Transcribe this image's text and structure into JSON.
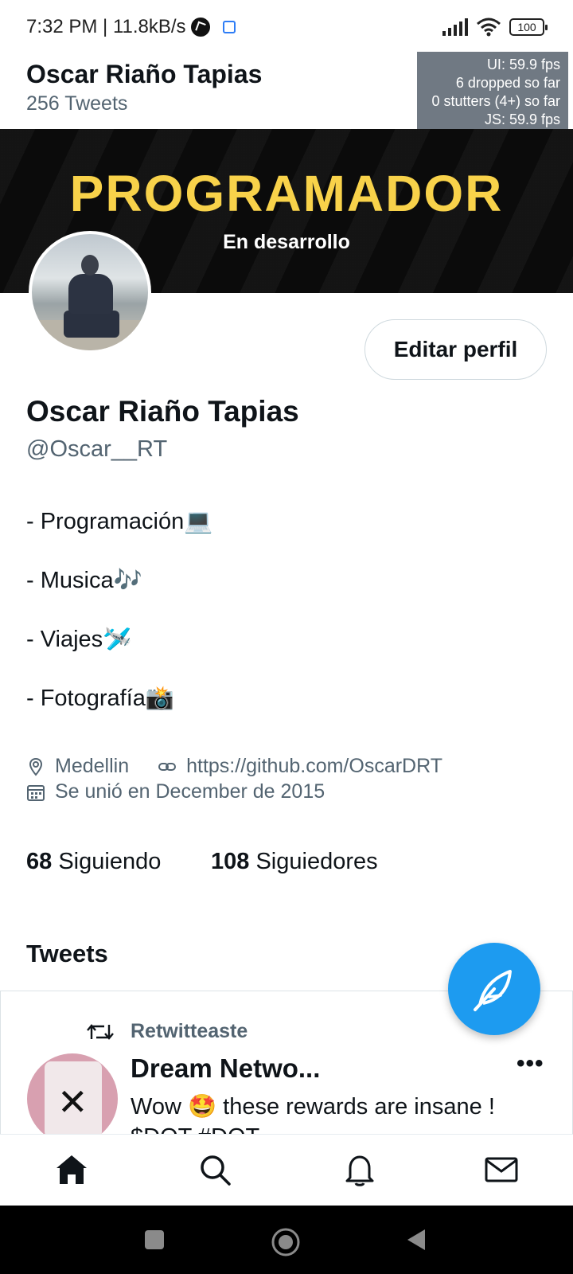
{
  "status_bar": {
    "time_speed": "7:32 PM | 11.8kB/s",
    "battery": "100"
  },
  "header": {
    "name": "Oscar Riaño Tapias",
    "tweet_count": "256 Tweets"
  },
  "fps_overlay": {
    "ui": "UI: 59.9 fps",
    "dropped": "6 dropped so far",
    "stutters": "0 stutters (4+) so far",
    "js": "JS: 59.9 fps"
  },
  "banner": {
    "title": "PROGRAMADOR",
    "subtitle": "En desarrollo"
  },
  "profile": {
    "edit_label": "Editar perfil",
    "name": "Oscar Riaño Tapias",
    "handle": "@Oscar__RT",
    "bio": [
      "- Programación💻",
      "- Musica🎶",
      "- Viajes🛩️",
      "- Fotografía📸"
    ],
    "location": "Medellin",
    "website": "https://github.com/OscarDRT",
    "joined": "Se unió en December de 2015",
    "following_count": "68",
    "following_label": "Siguiendo",
    "followers_count": "108",
    "followers_label": "Siguiedores"
  },
  "tweets": {
    "heading": "Tweets",
    "items": [
      {
        "retweet_label": "Retwitteaste",
        "author": "Dream Netwo...",
        "more": "•••",
        "text": "Wow 🤩 these rewards are insane ! $DOT #DOT"
      }
    ]
  },
  "icons": {
    "compose": "feather-icon",
    "home": "home-icon",
    "search": "search-icon",
    "notifications": "bell-icon",
    "messages": "mail-icon"
  },
  "colors": {
    "accent": "#1d9bf0",
    "banner_title": "#f8d24a",
    "secondary_text": "#536471"
  }
}
